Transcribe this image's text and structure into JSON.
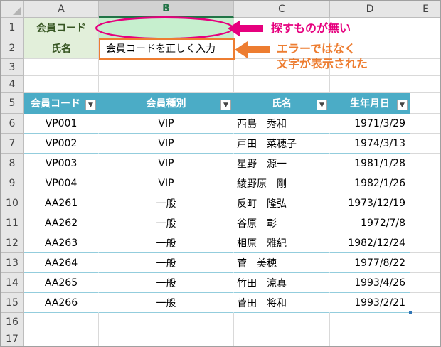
{
  "columns": [
    "A",
    "B",
    "C",
    "D",
    "E"
  ],
  "rows": [
    "1",
    "2",
    "3",
    "4",
    "5",
    "6",
    "7",
    "8",
    "9",
    "10",
    "11",
    "12",
    "13",
    "14",
    "15",
    "16",
    "17"
  ],
  "lookup": {
    "id_label": "会員コード",
    "id_value": "",
    "name_label": "氏名",
    "name_value": "会員コードを正しく入力"
  },
  "table": {
    "headers": [
      "会員コード",
      "会員種別",
      "氏名",
      "生年月日"
    ],
    "rows": [
      [
        "VP001",
        "VIP",
        "西島　秀和",
        "1971/3/29"
      ],
      [
        "VP002",
        "VIP",
        "戸田　菜穂子",
        "1974/3/13"
      ],
      [
        "VP003",
        "VIP",
        "星野　源一",
        "1981/1/28"
      ],
      [
        "VP004",
        "VIP",
        "綾野原　剛",
        "1982/1/26"
      ],
      [
        "AA261",
        "一般",
        "反町　隆弘",
        "1973/12/19"
      ],
      [
        "AA262",
        "一般",
        "谷原　彰",
        "1972/7/8"
      ],
      [
        "AA263",
        "一般",
        "相原　雅紀",
        "1982/12/24"
      ],
      [
        "AA264",
        "一般",
        "菅　美穂",
        "1977/8/22"
      ],
      [
        "AA265",
        "一般",
        "竹田　涼真",
        "1993/4/26"
      ],
      [
        "AA266",
        "一般",
        "菅田　将和",
        "1993/2/21"
      ]
    ]
  },
  "annotations": {
    "top": "探すものが無い",
    "bottom_line1": "エラーではなく",
    "bottom_line2": "文字が表示された"
  },
  "colors": {
    "header_blue": "#4bacc6",
    "label_green_bg": "#e2efda",
    "input_green_bg": "#c6efce",
    "annotation_pink": "#e6007e",
    "annotation_orange": "#ed7d31"
  },
  "icons": [
    "filter-dropdown-icon",
    "select-all-icon",
    "arrow-icon"
  ]
}
